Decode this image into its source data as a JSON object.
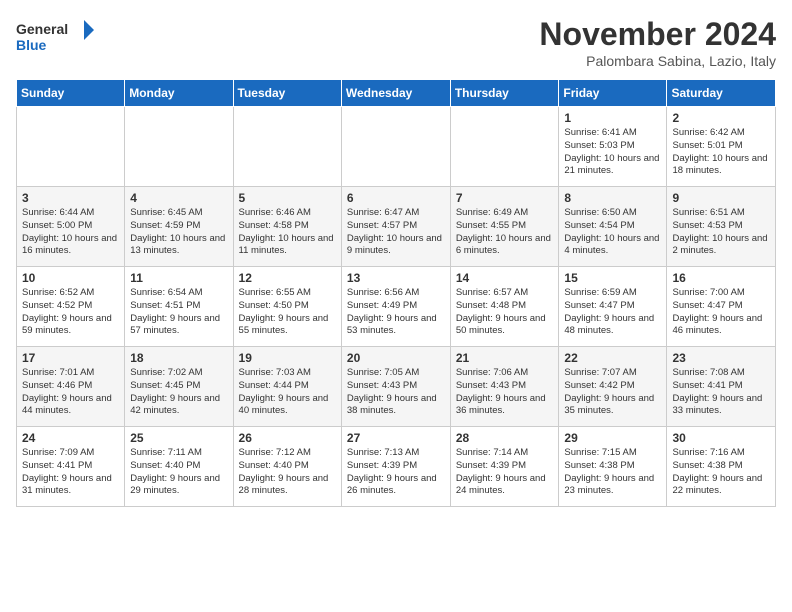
{
  "logo": {
    "line1": "General",
    "line2": "Blue"
  },
  "calendar": {
    "title": "November 2024",
    "subtitle": "Palombara Sabina, Lazio, Italy",
    "headers": [
      "Sunday",
      "Monday",
      "Tuesday",
      "Wednesday",
      "Thursday",
      "Friday",
      "Saturday"
    ],
    "rows": [
      [
        {
          "day": "",
          "info": ""
        },
        {
          "day": "",
          "info": ""
        },
        {
          "day": "",
          "info": ""
        },
        {
          "day": "",
          "info": ""
        },
        {
          "day": "",
          "info": ""
        },
        {
          "day": "1",
          "info": "Sunrise: 6:41 AM\nSunset: 5:03 PM\nDaylight: 10 hours and 21 minutes."
        },
        {
          "day": "2",
          "info": "Sunrise: 6:42 AM\nSunset: 5:01 PM\nDaylight: 10 hours and 18 minutes."
        }
      ],
      [
        {
          "day": "3",
          "info": "Sunrise: 6:44 AM\nSunset: 5:00 PM\nDaylight: 10 hours and 16 minutes."
        },
        {
          "day": "4",
          "info": "Sunrise: 6:45 AM\nSunset: 4:59 PM\nDaylight: 10 hours and 13 minutes."
        },
        {
          "day": "5",
          "info": "Sunrise: 6:46 AM\nSunset: 4:58 PM\nDaylight: 10 hours and 11 minutes."
        },
        {
          "day": "6",
          "info": "Sunrise: 6:47 AM\nSunset: 4:57 PM\nDaylight: 10 hours and 9 minutes."
        },
        {
          "day": "7",
          "info": "Sunrise: 6:49 AM\nSunset: 4:55 PM\nDaylight: 10 hours and 6 minutes."
        },
        {
          "day": "8",
          "info": "Sunrise: 6:50 AM\nSunset: 4:54 PM\nDaylight: 10 hours and 4 minutes."
        },
        {
          "day": "9",
          "info": "Sunrise: 6:51 AM\nSunset: 4:53 PM\nDaylight: 10 hours and 2 minutes."
        }
      ],
      [
        {
          "day": "10",
          "info": "Sunrise: 6:52 AM\nSunset: 4:52 PM\nDaylight: 9 hours and 59 minutes."
        },
        {
          "day": "11",
          "info": "Sunrise: 6:54 AM\nSunset: 4:51 PM\nDaylight: 9 hours and 57 minutes."
        },
        {
          "day": "12",
          "info": "Sunrise: 6:55 AM\nSunset: 4:50 PM\nDaylight: 9 hours and 55 minutes."
        },
        {
          "day": "13",
          "info": "Sunrise: 6:56 AM\nSunset: 4:49 PM\nDaylight: 9 hours and 53 minutes."
        },
        {
          "day": "14",
          "info": "Sunrise: 6:57 AM\nSunset: 4:48 PM\nDaylight: 9 hours and 50 minutes."
        },
        {
          "day": "15",
          "info": "Sunrise: 6:59 AM\nSunset: 4:47 PM\nDaylight: 9 hours and 48 minutes."
        },
        {
          "day": "16",
          "info": "Sunrise: 7:00 AM\nSunset: 4:47 PM\nDaylight: 9 hours and 46 minutes."
        }
      ],
      [
        {
          "day": "17",
          "info": "Sunrise: 7:01 AM\nSunset: 4:46 PM\nDaylight: 9 hours and 44 minutes."
        },
        {
          "day": "18",
          "info": "Sunrise: 7:02 AM\nSunset: 4:45 PM\nDaylight: 9 hours and 42 minutes."
        },
        {
          "day": "19",
          "info": "Sunrise: 7:03 AM\nSunset: 4:44 PM\nDaylight: 9 hours and 40 minutes."
        },
        {
          "day": "20",
          "info": "Sunrise: 7:05 AM\nSunset: 4:43 PM\nDaylight: 9 hours and 38 minutes."
        },
        {
          "day": "21",
          "info": "Sunrise: 7:06 AM\nSunset: 4:43 PM\nDaylight: 9 hours and 36 minutes."
        },
        {
          "day": "22",
          "info": "Sunrise: 7:07 AM\nSunset: 4:42 PM\nDaylight: 9 hours and 35 minutes."
        },
        {
          "day": "23",
          "info": "Sunrise: 7:08 AM\nSunset: 4:41 PM\nDaylight: 9 hours and 33 minutes."
        }
      ],
      [
        {
          "day": "24",
          "info": "Sunrise: 7:09 AM\nSunset: 4:41 PM\nDaylight: 9 hours and 31 minutes."
        },
        {
          "day": "25",
          "info": "Sunrise: 7:11 AM\nSunset: 4:40 PM\nDaylight: 9 hours and 29 minutes."
        },
        {
          "day": "26",
          "info": "Sunrise: 7:12 AM\nSunset: 4:40 PM\nDaylight: 9 hours and 28 minutes."
        },
        {
          "day": "27",
          "info": "Sunrise: 7:13 AM\nSunset: 4:39 PM\nDaylight: 9 hours and 26 minutes."
        },
        {
          "day": "28",
          "info": "Sunrise: 7:14 AM\nSunset: 4:39 PM\nDaylight: 9 hours and 24 minutes."
        },
        {
          "day": "29",
          "info": "Sunrise: 7:15 AM\nSunset: 4:38 PM\nDaylight: 9 hours and 23 minutes."
        },
        {
          "day": "30",
          "info": "Sunrise: 7:16 AM\nSunset: 4:38 PM\nDaylight: 9 hours and 22 minutes."
        }
      ]
    ]
  }
}
